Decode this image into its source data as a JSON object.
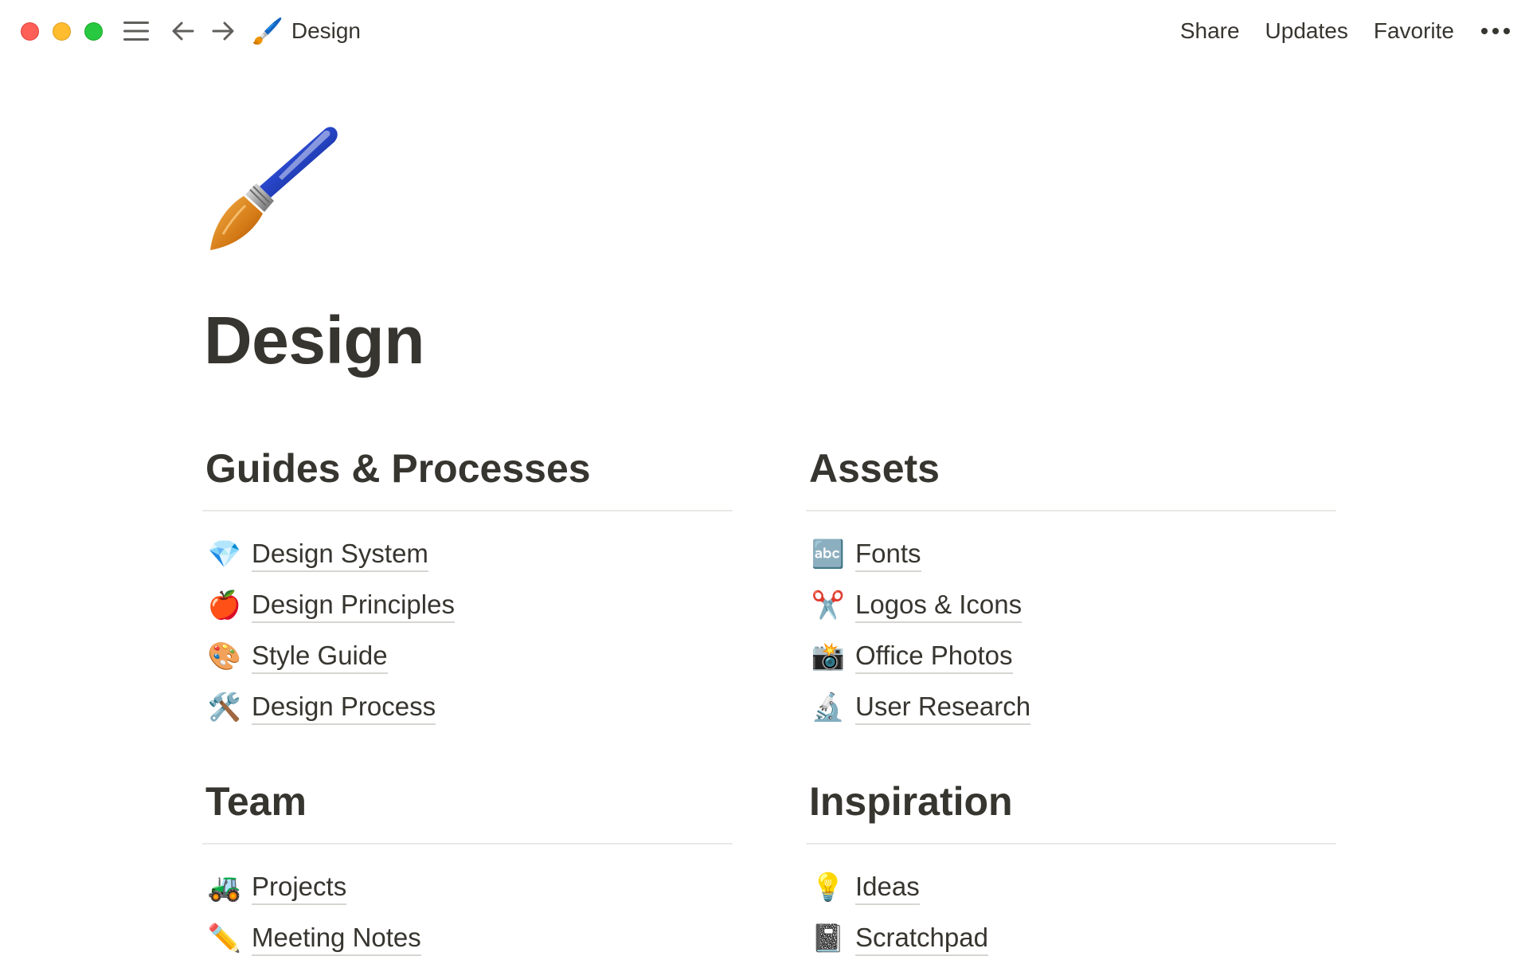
{
  "window": {
    "controls": [
      "close",
      "minimize",
      "zoom"
    ]
  },
  "topbar": {
    "breadcrumb": {
      "icon": "paintbrush-icon",
      "glyph": "🖌️",
      "label": "Design"
    },
    "actions": {
      "share": "Share",
      "updates": "Updates",
      "favorite": "Favorite"
    }
  },
  "page": {
    "icon": "paintbrush-icon",
    "title": "Design"
  },
  "sections": {
    "guides": {
      "heading": "Guides & Processes",
      "items": [
        {
          "glyph": "💎",
          "icon": "gem-icon",
          "label": "Design System"
        },
        {
          "glyph": "🍎",
          "icon": "apple-icon",
          "label": "Design Principles"
        },
        {
          "glyph": "🎨",
          "icon": "palette-icon",
          "label": "Style Guide"
        },
        {
          "glyph": "🛠️",
          "icon": "tools-icon",
          "label": "Design Process"
        }
      ]
    },
    "assets": {
      "heading": "Assets",
      "items": [
        {
          "glyph": "🔤",
          "icon": "abc-icon",
          "label": "Fonts"
        },
        {
          "glyph": "✂️",
          "icon": "scissors-icon",
          "label": "Logos & Icons"
        },
        {
          "glyph": "📸",
          "icon": "camera-flash-icon",
          "label": "Office Photos"
        },
        {
          "glyph": "🔬",
          "icon": "microscope-icon",
          "label": "User Research"
        }
      ]
    },
    "team": {
      "heading": "Team",
      "items": [
        {
          "glyph": "🚜",
          "icon": "tractor-icon",
          "label": "Projects"
        },
        {
          "glyph": "✏️",
          "icon": "pencil-icon",
          "label": "Meeting Notes"
        }
      ]
    },
    "inspiration": {
      "heading": "Inspiration",
      "items": [
        {
          "glyph": "💡",
          "icon": "lightbulb-icon",
          "label": "Ideas"
        },
        {
          "glyph": "📓",
          "icon": "notebook-icon",
          "label": "Scratchpad"
        }
      ]
    }
  },
  "colors": {
    "text": "#37352f",
    "divider": "#e9e9e7",
    "close": "#fe5f57",
    "minimize": "#febc2e",
    "zoom": "#28c840"
  }
}
